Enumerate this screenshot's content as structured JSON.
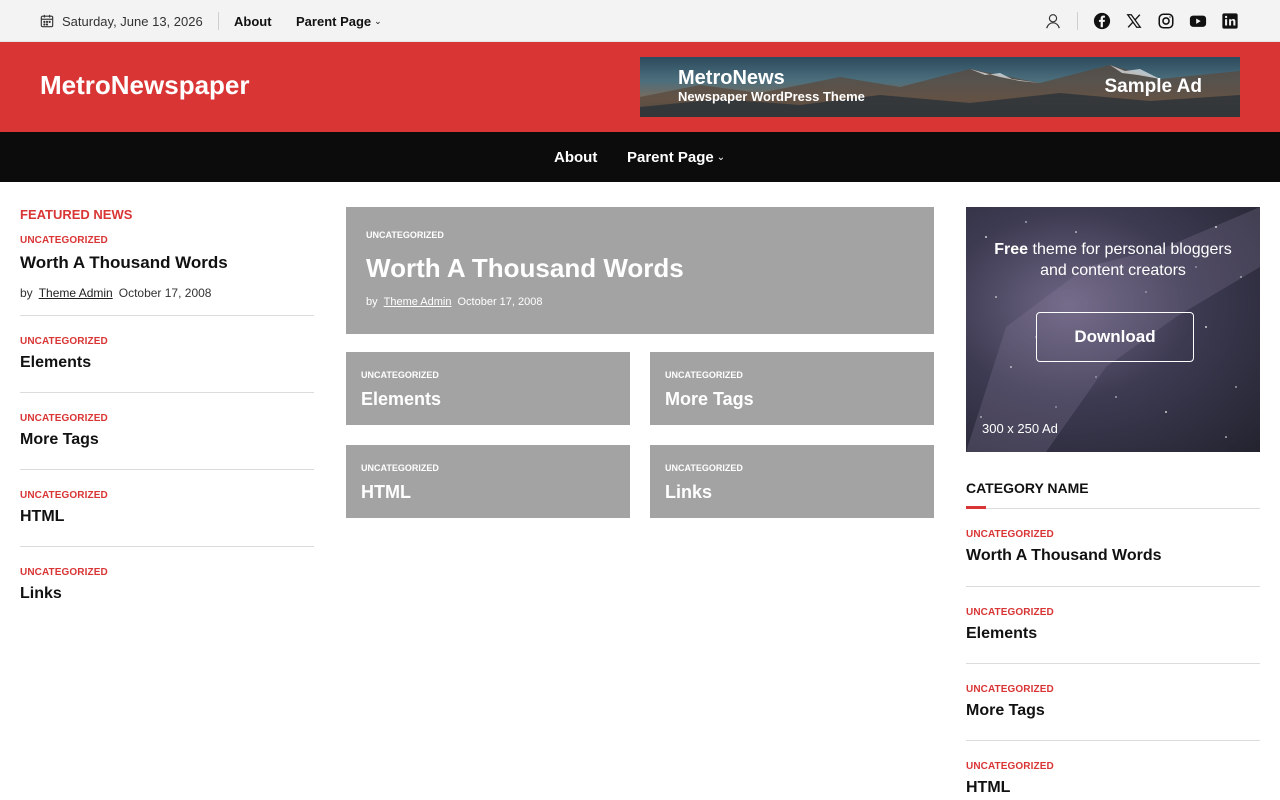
{
  "topbar": {
    "date": "Saturday, June 13, 2026",
    "nav": [
      {
        "label": "About"
      },
      {
        "label": "Parent Page"
      }
    ],
    "icons": [
      "user-icon",
      "facebook-icon",
      "x-twitter-icon",
      "instagram-icon",
      "youtube-icon",
      "linkedin-icon"
    ]
  },
  "header": {
    "logo": "MetroNewspaper",
    "ad": {
      "title": "MetroNews",
      "subtitle": "Newspaper WordPress Theme",
      "tag": "Sample Ad"
    }
  },
  "mainnav": [
    {
      "label": "About"
    },
    {
      "label": "Parent Page"
    }
  ],
  "featured": {
    "title": "FEATURED NEWS",
    "items": [
      {
        "category": "UNCATEGORIZED",
        "title": "Worth A Thousand Words",
        "by": "by",
        "author": "Theme Admin",
        "date": "October 17, 2008"
      },
      {
        "category": "UNCATEGORIZED",
        "title": "Elements"
      },
      {
        "category": "UNCATEGORIZED",
        "title": "More Tags"
      },
      {
        "category": "UNCATEGORIZED",
        "title": "HTML"
      },
      {
        "category": "UNCATEGORIZED",
        "title": "Links"
      }
    ]
  },
  "center": {
    "hero": {
      "category": "UNCATEGORIZED",
      "title": "Worth A Thousand Words",
      "by": "by",
      "author": "Theme Admin",
      "date": "October 17, 2008"
    },
    "cards": [
      {
        "category": "UNCATEGORIZED",
        "title": "Elements"
      },
      {
        "category": "UNCATEGORIZED",
        "title": "More Tags"
      },
      {
        "category": "UNCATEGORIZED",
        "title": "HTML"
      },
      {
        "category": "UNCATEGORIZED",
        "title": "Links"
      }
    ]
  },
  "sidebar": {
    "ad": {
      "line1_bold": "Free",
      "line1_rest": " theme for personal bloggers",
      "line2": "and content creators",
      "button": "Download",
      "size": "300 x 250 Ad"
    },
    "category_title": "CATEGORY NAME",
    "items": [
      {
        "category": "UNCATEGORIZED",
        "title": "Worth A Thousand Words"
      },
      {
        "category": "UNCATEGORIZED",
        "title": "Elements"
      },
      {
        "category": "UNCATEGORIZED",
        "title": "More Tags"
      },
      {
        "category": "UNCATEGORIZED",
        "title": "HTML"
      }
    ]
  },
  "colors": {
    "brand_red": "#d93535",
    "nav_black": "#0c0c0c",
    "card_gray": "#a3a3a3"
  }
}
